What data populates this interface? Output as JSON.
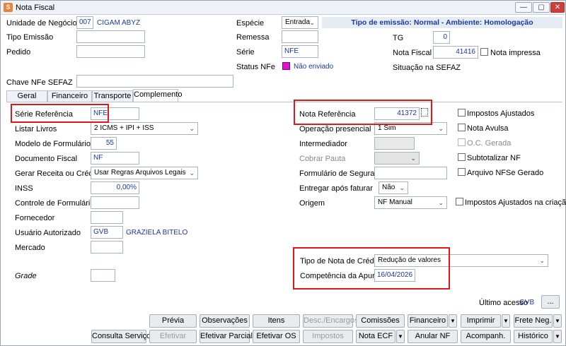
{
  "window": {
    "title": "Nota Fiscal",
    "app_icon": "S",
    "minimize": "—",
    "maximize": "▢",
    "close": "✕"
  },
  "header": {
    "unidade_label": "Unidade de Negócio",
    "unidade_code": "007",
    "unidade_name": "CIGAM ABYZ",
    "tipo_emissao_label": "Tipo Emissão",
    "tipo_emissao_value": "",
    "pedido_label": "Pedido",
    "pedido_value": "",
    "especie_label": "Espécie",
    "especie_value": "Entrada",
    "remessa_label": "Remessa",
    "remessa_value": "",
    "serie_label": "Série",
    "serie_value": "NFE",
    "status_label": "Status NFe",
    "status_value": "Não enviado",
    "banner": "Tipo de emissão: Normal - Ambiente: Homologação",
    "tg_label": "TG",
    "tg_value": "0",
    "nota_fiscal_label": "Nota Fiscal",
    "nota_fiscal_value": "41416",
    "nota_impressa_label": "Nota impressa",
    "situacao_label": "Situação na SEFAZ",
    "chave_label": "Chave NFe SEFAZ",
    "chave_value": ""
  },
  "tabs": [
    {
      "label": "Geral"
    },
    {
      "label": "Financeiro"
    },
    {
      "label": "Transporte"
    },
    {
      "label": "Complemento"
    }
  ],
  "left": {
    "serie_ref_label": "Série Referência",
    "serie_ref_value": "NFE",
    "listar_livros_label": "Listar Livros",
    "listar_livros_value": "2 ICMS + IPI + ISS",
    "modelo_label": "Modelo de Formulário",
    "modelo_value": "55",
    "documento_label": "Documento Fiscal",
    "documento_value": "NF",
    "gerar_label": "Gerar Receita ou Crédito",
    "gerar_value": "Usar Regras Arquivos Legais",
    "inss_label": "INSS",
    "inss_value": "0,00%",
    "controle_label": "Controle de Formulário",
    "controle_value": "",
    "fornecedor_label": "Fornecedor",
    "fornecedor_value": "",
    "usuario_label": "Usuário Autorizado",
    "usuario_code": "GVB",
    "usuario_name": "GRAZIELA BITELO",
    "mercado_label": "Mercado",
    "mercado_value": "",
    "grade_label": "Grade",
    "grade_value": ""
  },
  "middle": {
    "nota_ref_label": "Nota Referência",
    "nota_ref_value": "41372",
    "operacao_label": "Operação presencial",
    "operacao_value": "1 Sim",
    "intermediador_label": "Intermediador",
    "intermediador_value": "",
    "cobrar_label": "Cobrar Pauta",
    "cobrar_value": "",
    "formulario_seg_label": "Formulário de Segurança",
    "formulario_seg_value": "",
    "entregar_label": "Entregar após faturar",
    "entregar_value": "Não",
    "origem_label": "Origem",
    "origem_value": "NF Manual",
    "tipo_nota_label": "Tipo de Nota de Crédito",
    "tipo_nota_value": "Redução de valores",
    "competencia_label": "Competência da Apuração",
    "competencia_value": "16/04/2026"
  },
  "checks": {
    "impostos_ajustados": "Impostos Ajustados",
    "nota_avulsa": "Nota Avulsa",
    "oc_gerada": "O.C. Gerada",
    "subtotalizar": "Subtotalizar NF",
    "arquivo_nfse": "Arquivo NFSe Gerado",
    "impostos_criacao": "Impostos Ajustados na criação"
  },
  "footer": {
    "ultimo_acesso_label": "Último acesso",
    "ultimo_acesso_value": "GVB",
    "more": "..."
  },
  "buttons": {
    "row1": [
      "Prévia",
      "Observações",
      "Itens",
      "Desc./Encargos",
      "Comissões",
      "Financeiro",
      "Imprimir",
      "Frete Neg."
    ],
    "row2": [
      "Consulta Serviços",
      "Efetivar",
      "Efetivar Parcial",
      "Efetivar OS",
      "Impostos",
      "Nota ECF",
      "Anular NF",
      "Acompanh.",
      "Histórico"
    ],
    "arrow": "▼"
  },
  "colors": {
    "accent_blue": "#1a37a8",
    "highlight_red": "#e01818",
    "status_swatch": "#e010d0"
  },
  "icons": {
    "dropdown": "chevron-down-icon",
    "status": "status-swatch-icon"
  }
}
